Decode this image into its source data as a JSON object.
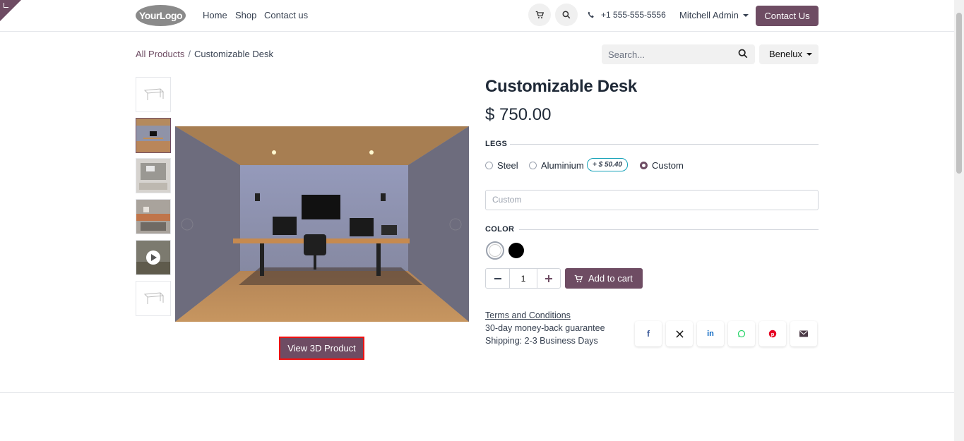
{
  "header": {
    "logo_text": "YourLogo",
    "nav": [
      "Home",
      "Shop",
      "Contact us"
    ],
    "phone": "+1 555-555-5556",
    "user": "Mitchell Admin",
    "contact_button": "Contact Us"
  },
  "breadcrumb": {
    "root": "All Products",
    "separator": "/",
    "current": "Customizable Desk"
  },
  "search": {
    "placeholder": "Search..."
  },
  "pricelist": "Benelux",
  "product": {
    "name": "Customizable Desk",
    "price": "$ 750.00",
    "legs_label": "LEGS",
    "legs_options": [
      "Steel",
      "Aluminium",
      "Custom"
    ],
    "legs_selected": "Custom",
    "aluminium_extra": "+ $ 50.40",
    "custom_placeholder": "Custom",
    "color_label": "COLOR",
    "colors": [
      "#ffffff",
      "#000000"
    ],
    "quantity": "1",
    "add_to_cart": "Add to cart",
    "view_3d": "View 3D Product"
  },
  "info": {
    "terms": "Terms and Conditions",
    "guarantee": "30-day money-back guarantee",
    "shipping": "Shipping: 2-3 Business Days"
  },
  "share_icons": [
    "facebook-icon",
    "x-icon",
    "linkedin-icon",
    "whatsapp-icon",
    "pinterest-icon",
    "email-icon"
  ],
  "colors": {
    "brand": "#6e4c63",
    "highlight": "#e11111"
  }
}
